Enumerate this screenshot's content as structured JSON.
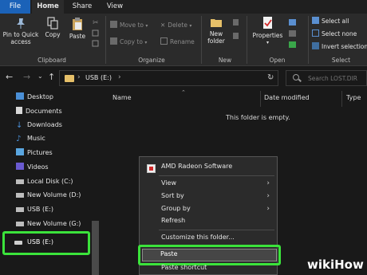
{
  "ribbon": {
    "tabs": [
      "File",
      "Home",
      "Share",
      "View"
    ],
    "clipboard": {
      "pin_label_line1": "Pin to Quick",
      "pin_label_line2": "access",
      "copy_label": "Copy",
      "paste_label": "Paste",
      "group_label": "Clipboard"
    },
    "organize": {
      "move_to": "Move to",
      "copy_to": "Copy to",
      "delete": "Delete",
      "rename": "Rename",
      "group_label": "Organize"
    },
    "new": {
      "new_folder_line1": "New",
      "new_folder_line2": "folder",
      "group_label": "New"
    },
    "open": {
      "properties": "Properties",
      "group_label": "Open"
    },
    "select": {
      "select_all": "Select all",
      "select_none": "Select none",
      "invert_selection": "Invert selection",
      "group_label": "Select"
    }
  },
  "address": {
    "crumb": "USB (E:)",
    "search_placeholder": "Search LOST.DIR"
  },
  "nav_pane": {
    "items": [
      "Desktop",
      "Documents",
      "Downloads",
      "Music",
      "Pictures",
      "Videos",
      "Local Disk (C:)",
      "New Volume (D:)",
      "USB (E:)",
      "New Volume (G:)"
    ],
    "selected": "USB (E:)"
  },
  "file_list": {
    "columns": [
      "Name",
      "Date modified",
      "Type"
    ],
    "empty_text": "This folder is empty."
  },
  "context_menu": {
    "amd": "AMD Radeon Software",
    "view": "View",
    "sort_by": "Sort by",
    "group_by": "Group by",
    "refresh": "Refresh",
    "customize": "Customize this folder...",
    "paste": "Paste",
    "paste_shortcut": "Paste shortcut"
  },
  "watermark": {
    "brand": "wikiHow"
  },
  "colors": {
    "highlight": "#3be33b",
    "file_tab": "#1b62b8",
    "folder": "#e6c069"
  }
}
